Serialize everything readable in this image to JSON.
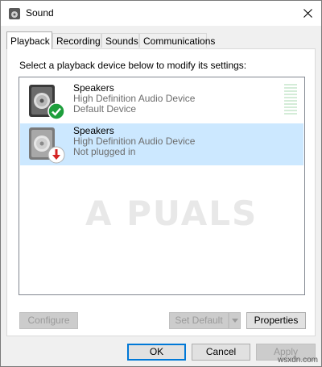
{
  "window": {
    "title": "Sound"
  },
  "tabs": [
    {
      "label": "Playback",
      "active": true
    },
    {
      "label": "Recording",
      "active": false
    },
    {
      "label": "Sounds",
      "active": false
    },
    {
      "label": "Communications",
      "active": false
    }
  ],
  "instruction": "Select a playback device below to modify its settings:",
  "devices": [
    {
      "name": "Speakers",
      "driver": "High Definition Audio Device",
      "status": "Default Device",
      "badge": "check-icon",
      "badge_color": "#1e9e3c",
      "selected": false
    },
    {
      "name": "Speakers",
      "driver": "High Definition Audio Device",
      "status": "Not plugged in",
      "badge": "arrow-down-icon",
      "badge_color": "#d42323",
      "selected": true
    }
  ],
  "buttons": {
    "configure": "Configure",
    "set_default": "Set Default",
    "properties": "Properties",
    "ok": "OK",
    "cancel": "Cancel",
    "apply": "Apply"
  },
  "watermark": {
    "brand": "A  PUALS",
    "site": "wsxdn.com"
  },
  "colors": {
    "selection": "#cce8ff",
    "accent": "#0078d7"
  }
}
